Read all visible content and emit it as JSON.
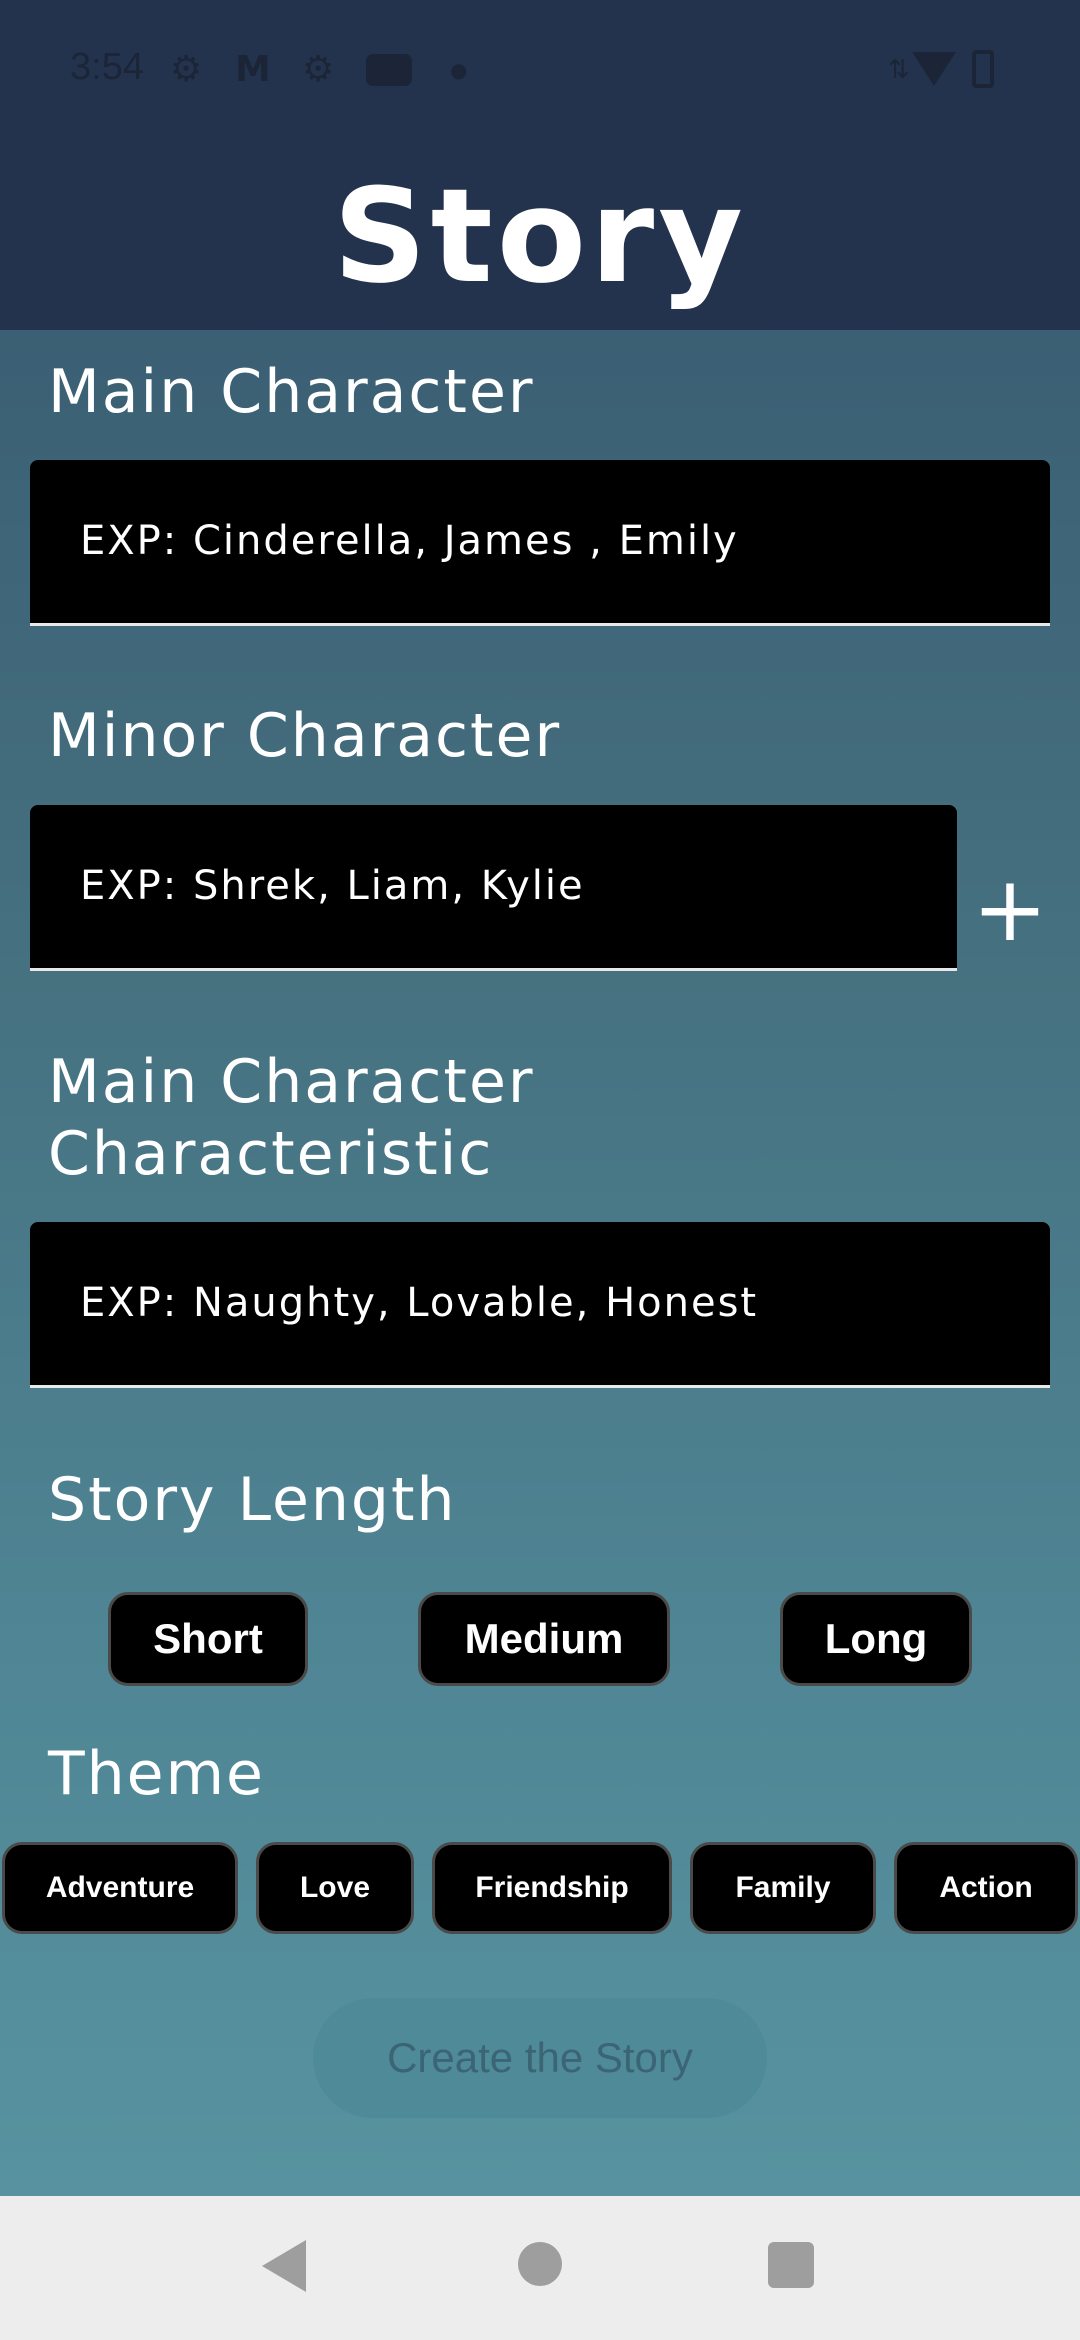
{
  "status_bar": {
    "time": "3:54",
    "icons": [
      "gear-icon",
      "gmail-icon",
      "gear-icon",
      "youtube-icon",
      "dot-icon",
      "wifi-icon",
      "battery-icon"
    ]
  },
  "header": {
    "title": "Story"
  },
  "main_character": {
    "label": "Main Character",
    "placeholder": "EXP: Cinderella, James , Emily"
  },
  "minor_character": {
    "label": "Minor Character",
    "placeholder": "EXP: Shrek, Liam, Kylie",
    "add_label": "+"
  },
  "characteristic": {
    "label_line1": "Main Character",
    "label_line2": "Characteristic",
    "placeholder": "EXP: Naughty, Lovable, Honest"
  },
  "story_length": {
    "label": "Story Length",
    "options": [
      "Short",
      "Medium",
      "Long"
    ]
  },
  "theme": {
    "label": "Theme",
    "options": [
      "Adventure",
      "Love",
      "Friendship",
      "Family",
      "Action"
    ]
  },
  "create_button": {
    "label": "Create the Story"
  },
  "colors": {
    "header_bg": "#24334d",
    "field_bg": "#000000",
    "nav_bg": "#ededed"
  }
}
